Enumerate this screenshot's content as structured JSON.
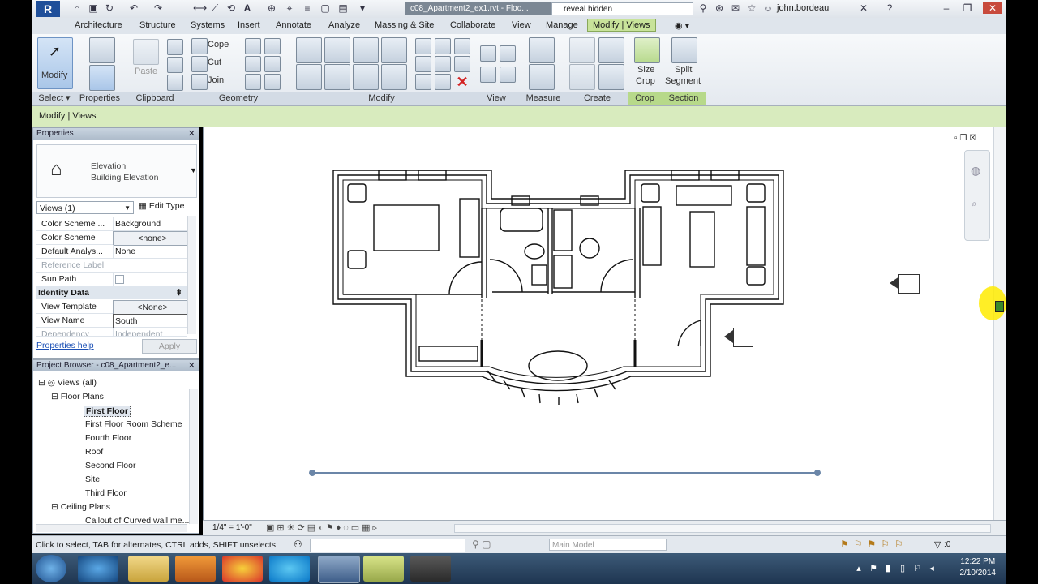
{
  "titlebar": {
    "document_title": "c08_Apartment2_ex1.rvt - Floo...",
    "search_value": "reveal hidden",
    "user": "john.bordeau"
  },
  "ribbon": {
    "tabs": [
      "Architecture",
      "Structure",
      "Systems",
      "Insert",
      "Annotate",
      "Analyze",
      "Massing & Site",
      "Collaborate",
      "View",
      "Manage",
      "Modify | Views"
    ],
    "active_tab": "Modify | Views",
    "buttons": {
      "modify": "Modify",
      "paste": "Paste",
      "cope": "Cope",
      "cut": "Cut",
      "join": "Join",
      "size_crop_1": "Size",
      "size_crop_2": "Crop",
      "split_1": "Split",
      "split_2": "Segment"
    },
    "panels": [
      "Select",
      "Properties",
      "Clipboard",
      "Geometry",
      "Modify",
      "View",
      "Measure",
      "Create",
      "Crop",
      "Section"
    ]
  },
  "options_bar": {
    "label": "Modify | Views"
  },
  "properties": {
    "header": "Properties",
    "type_line1": "Elevation",
    "type_line2": "Building Elevation",
    "selector": "Views (1)",
    "edit_type": "Edit Type",
    "rows": [
      {
        "key": "Color Scheme ...",
        "value": "Background"
      },
      {
        "key": "Color Scheme",
        "value": "<none>"
      },
      {
        "key": "Default Analys...",
        "value": "None"
      },
      {
        "key": "Reference Label",
        "value": ""
      },
      {
        "key": "Sun Path",
        "value": ""
      }
    ],
    "section": "Identity Data",
    "identity_rows": [
      {
        "key": "View Template",
        "value": "<None>"
      },
      {
        "key": "View Name",
        "value": "South"
      },
      {
        "key": "Dependency",
        "value": "Independent"
      }
    ],
    "help": "Properties help",
    "apply": "Apply"
  },
  "browser": {
    "header": "Project Browser - c08_Apartment2_e...",
    "views_all": "Views (all)",
    "floor_plans": "Floor Plans",
    "floor_items": [
      "First Floor",
      "First Floor Room Scheme",
      "Fourth Floor",
      "Roof",
      "Second Floor",
      "Site",
      "Third Floor"
    ],
    "ceiling_plans": "Ceiling Plans",
    "ceiling_item": "Callout of Curved wall me..."
  },
  "viewcontrol": {
    "scale": "1/4\" = 1'-0\""
  },
  "status": {
    "message": "Click to select, TAB for alternates, CTRL adds, SHIFT unselects.",
    "model": "Main Model",
    "filter_count": ":0"
  },
  "taskbar": {
    "time": "12:22 PM",
    "date": "2/10/2014"
  },
  "colors": {
    "ribbon_active": "#c8e39a",
    "options_bar": "#d8ebbe",
    "taskbar": "#2a4562",
    "elevation_line": "#6b86a8"
  }
}
